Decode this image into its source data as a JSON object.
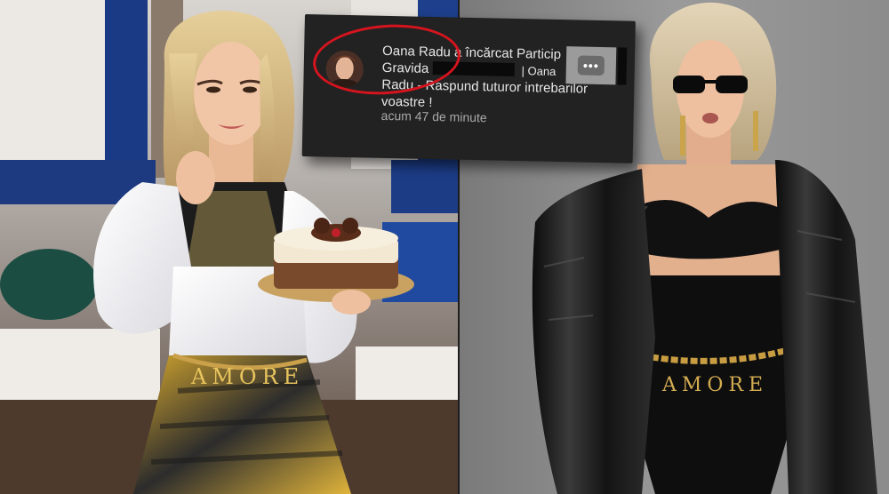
{
  "notification": {
    "line1": "Oana Radu a încărcat Particip",
    "line2": "Gravida",
    "line2_tail": "| Oana",
    "line3": "Radu - Raspund tuturor intrebarilor",
    "line4": "voastre !",
    "time": "acum 47 de minute",
    "thumb_icon": "•••"
  },
  "belt_left": "AMORE",
  "belt_right": "AMORE",
  "colors": {
    "highlight_ring": "#d6141e",
    "card_bg": "#222222",
    "right_backdrop": "#8f8f8f"
  },
  "icons": [
    "more-options-icon"
  ]
}
